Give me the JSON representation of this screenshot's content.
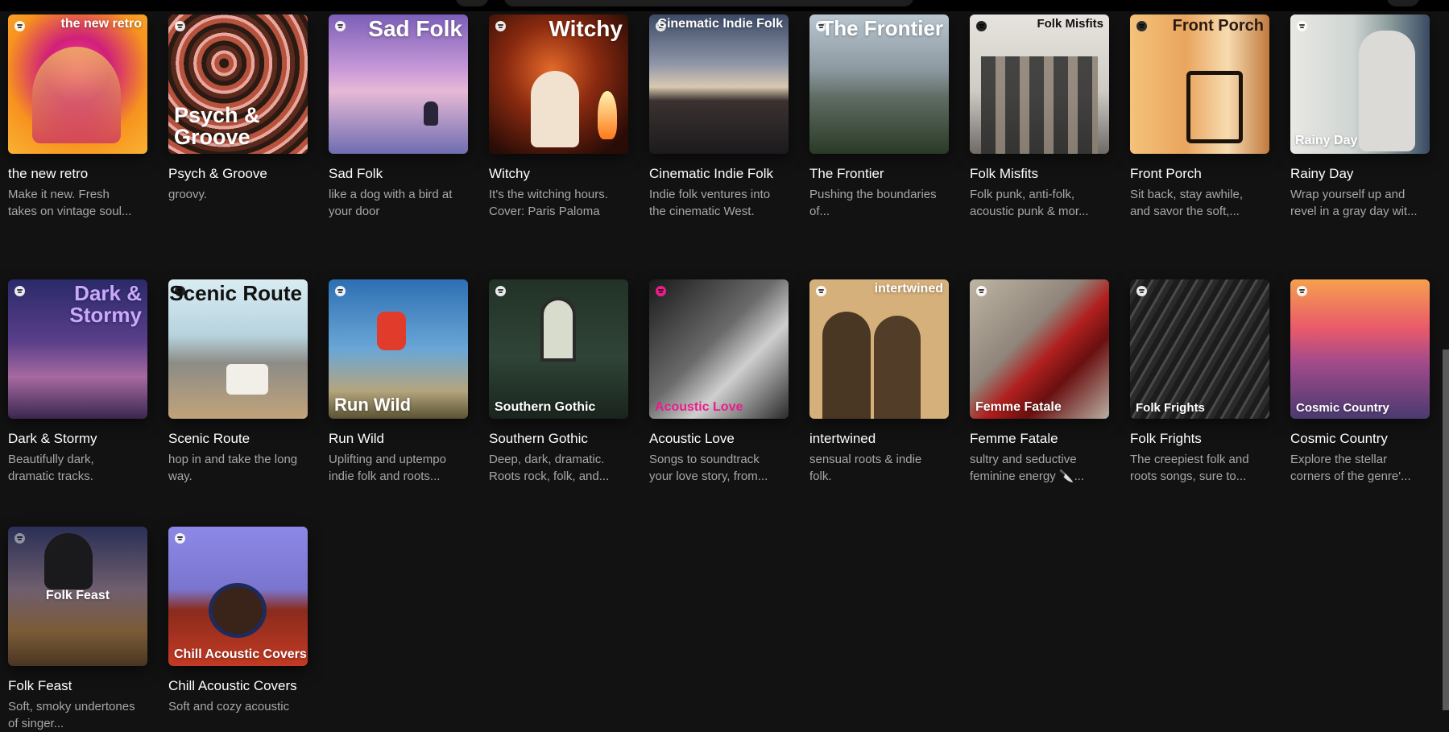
{
  "playlists_row1": [
    {
      "title": "the new retro",
      "description": "Make it new. Fresh takes on vintage soul...",
      "cover_text": "the new retro"
    },
    {
      "title": "Psych & Groove",
      "description": "groovy.",
      "cover_text": "Psych & Groove"
    },
    {
      "title": "Sad Folk",
      "description": "like a dog with a bird at your door",
      "cover_text": "Sad Folk"
    },
    {
      "title": "Witchy",
      "description": "It's the witching hours. Cover: Paris Paloma",
      "cover_text": "Witchy"
    },
    {
      "title": "Cinematic Indie Folk",
      "description": "Indie folk ventures into the cinematic West.",
      "cover_text": "Cinematic Indie Folk"
    },
    {
      "title": "The Frontier",
      "description": "Pushing the boundaries of...",
      "cover_text": "The Frontier"
    },
    {
      "title": "Folk Misfits",
      "description": "Folk punk, anti-folk, acoustic punk & mor...",
      "cover_text": "Folk Misfits"
    },
    {
      "title": "Front Porch",
      "description": "Sit back, stay awhile, and savor the soft,...",
      "cover_text": "Front Porch"
    },
    {
      "title": "Rainy Day",
      "description": "Wrap yourself up and revel in a gray day wit...",
      "cover_text": "Rainy Day"
    }
  ],
  "playlists_row2": [
    {
      "title": "Dark & Stormy",
      "description": "Beautifully dark, dramatic tracks.",
      "cover_text": "Dark & Stormy"
    },
    {
      "title": "Scenic Route",
      "description": "hop in and take the long way.",
      "cover_text": "Scenic Route"
    },
    {
      "title": "Run Wild",
      "description": "Uplifting and uptempo indie folk and roots...",
      "cover_text": "Run Wild"
    },
    {
      "title": "Southern Gothic",
      "description": "Deep, dark, dramatic. Roots rock, folk, and...",
      "cover_text": "Southern Gothic"
    },
    {
      "title": "Acoustic Love",
      "description": "Songs to soundtrack your love story, from...",
      "cover_text": "Acoustic Love"
    },
    {
      "title": "intertwined",
      "description": "sensual roots & indie folk.",
      "cover_text": "intertwined"
    },
    {
      "title": "Femme Fatale",
      "description": "sultry and seductive feminine energy 🔪...",
      "cover_text": "Femme Fatale"
    },
    {
      "title": "Folk Frights",
      "description": "The creepiest folk and roots songs, sure to...",
      "cover_text": "Folk Frights"
    },
    {
      "title": "Cosmic Country",
      "description": "Explore the stellar corners of the genre'...",
      "cover_text": "Cosmic Country"
    }
  ],
  "playlists_row3": [
    {
      "title": "Folk Feast",
      "description": "Soft, smoky undertones of singer...",
      "cover_text": "Folk Feast"
    },
    {
      "title": "Chill Acoustic Covers",
      "description": "Soft and cozy acoustic",
      "cover_text": "Chill Acoustic Covers"
    }
  ],
  "icons": {
    "playlist_badge": "spotify-logo-icon"
  },
  "colors": {
    "background": "#121212",
    "title": "#ffffff",
    "description": "#a7a7a7",
    "accent_pink": "#e91e8c"
  }
}
